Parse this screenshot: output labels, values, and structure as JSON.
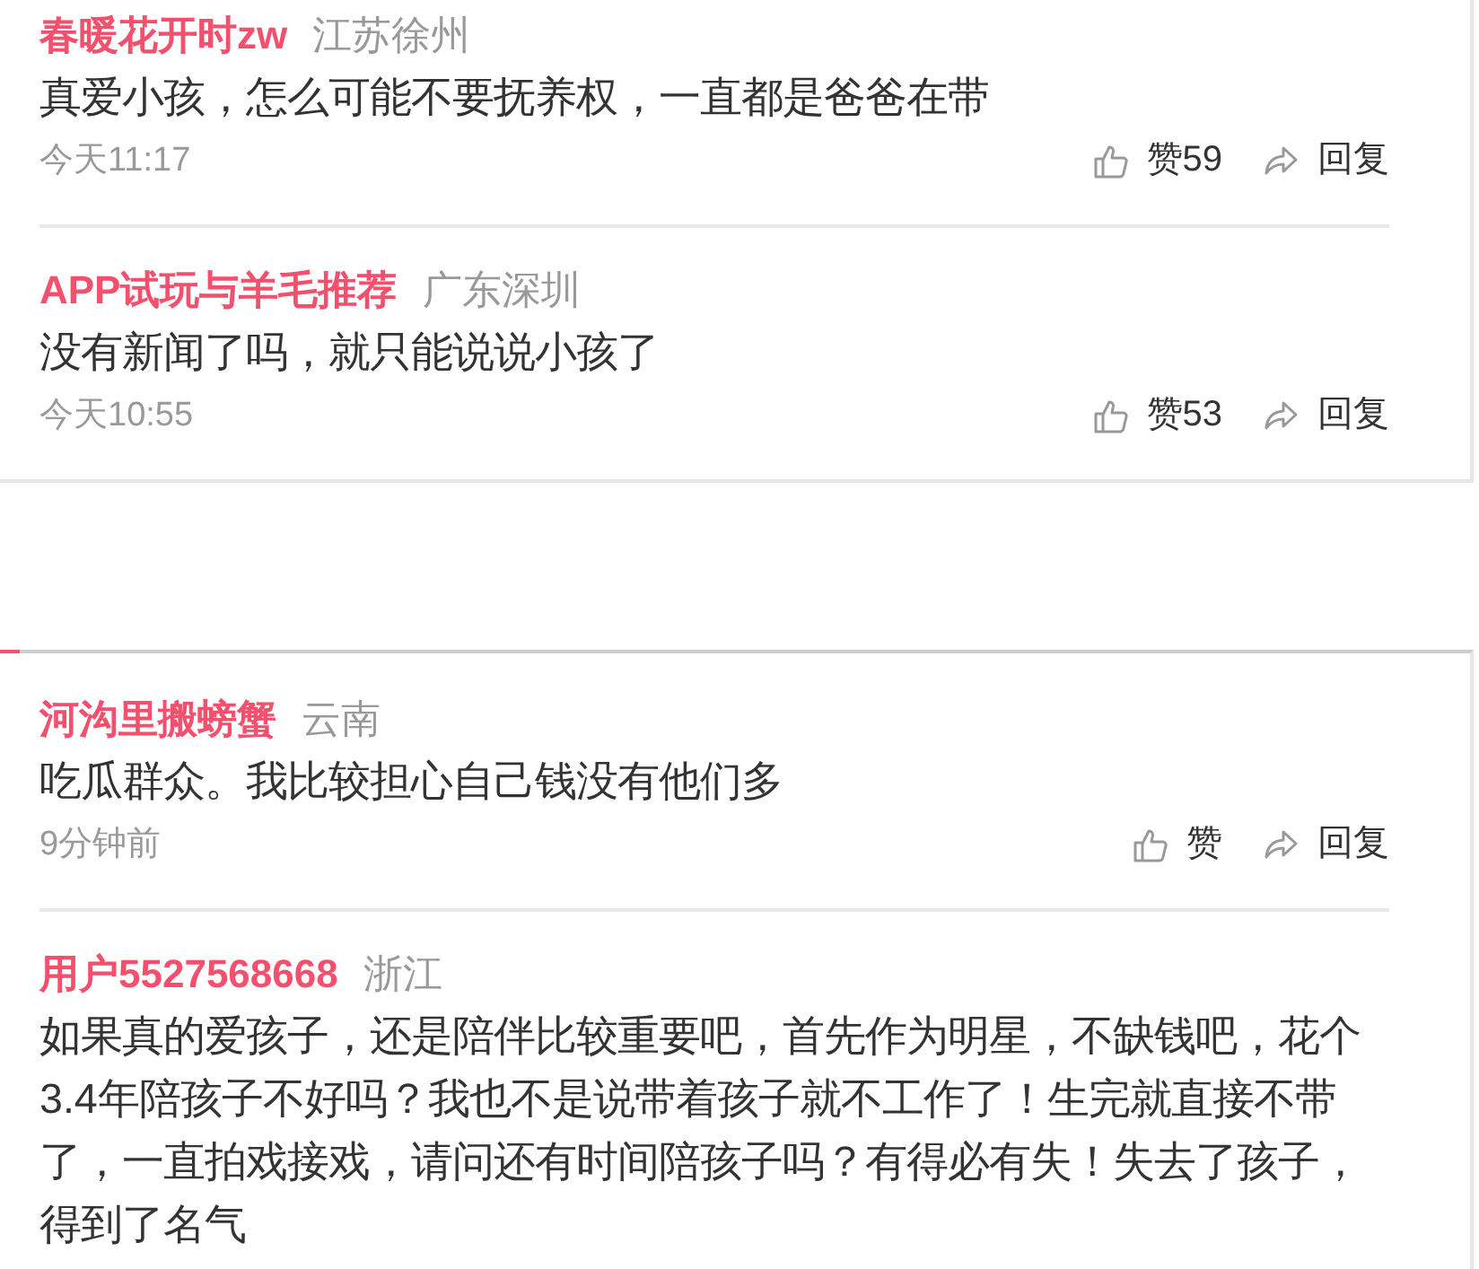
{
  "sections": [
    {
      "highlighted": false,
      "comments": [
        {
          "user": "春暖花开时zw",
          "location": "江苏徐州",
          "text": "真爱小孩，怎么可能不要抚养权，一直都是爸爸在带",
          "time": "今天11:17",
          "like_label": "赞59",
          "reply_label": "回复"
        },
        {
          "user": "APP试玩与羊毛推荐",
          "location": "广东深圳",
          "text": "没有新闻了吗，就只能说说小孩了",
          "time": "今天10:55",
          "like_label": "赞53",
          "reply_label": "回复"
        }
      ]
    },
    {
      "highlighted": true,
      "comments": [
        {
          "user": "河沟里搬螃蟹",
          "location": "云南",
          "text": "吃瓜群众。我比较担心自己钱没有他们多",
          "time": "9分钟前",
          "like_label": "赞",
          "reply_label": "回复"
        },
        {
          "user": "用户5527568668",
          "location": "浙江",
          "text": "如果真的爱孩子，还是陪伴比较重要吧，首先作为明星，不缺钱吧，花个3.4年陪孩子不好吗？我也不是说带着孩子就不工作了！生完就直接不带了，一直拍戏接戏，请问还有时间陪孩子吗？有得必有失！失去了孩子，得到了名气"
        }
      ]
    }
  ]
}
